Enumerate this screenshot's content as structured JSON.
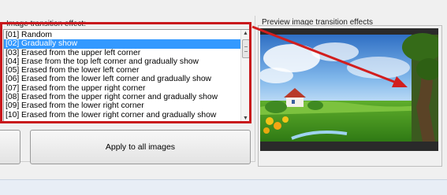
{
  "left_panel": {
    "group_label": "Image transition effect:",
    "items": [
      "[01] Random",
      "[02] Gradually show",
      "[03] Erased from the upper left corner",
      "[04] Erase from the top left corner and gradually show",
      "[05] Erased from the lower left corner",
      "[06] Erased from the lower left corner and gradually show",
      "[07] Erased from the upper right corner",
      "[08] Erased from the upper right corner and gradually show",
      "[09] Erased from the lower right corner",
      "[10] Erased from the lower right corner and gradually show"
    ],
    "selected_index": 1
  },
  "buttons": {
    "apply_label": "Apply to all images"
  },
  "right_panel": {
    "preview_label": "Preview image transition effects"
  },
  "annotation": {
    "highlight_color": "#c8181c",
    "arrow_color": "#d21e1e"
  },
  "icons": {
    "scroll_up": "scroll-up-arrow-icon",
    "scroll_down": "scroll-down-arrow-icon"
  }
}
